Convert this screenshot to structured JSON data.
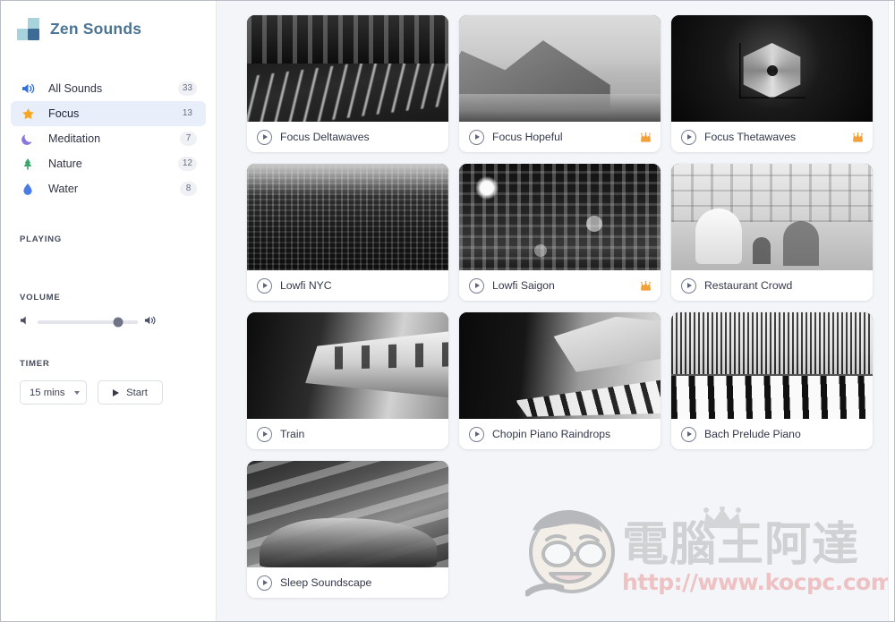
{
  "app": {
    "title": "Zen Sounds",
    "logo_icon": "blocks-logo-icon",
    "brand_color": "#4b7494"
  },
  "sidebar": {
    "nav": [
      {
        "icon": "speaker-icon",
        "label": "All Sounds",
        "count": "33",
        "active": false,
        "color": "#2f6fe0"
      },
      {
        "icon": "star-icon",
        "label": "Focus",
        "count": "13",
        "active": true,
        "color": "#f5a623"
      },
      {
        "icon": "moon-icon",
        "label": "Meditation",
        "count": "7",
        "active": false,
        "color": "#8a74e0"
      },
      {
        "icon": "tree-icon",
        "label": "Nature",
        "count": "12",
        "active": false,
        "color": "#3aa76d"
      },
      {
        "icon": "droplet-icon",
        "label": "Water",
        "count": "8",
        "active": false,
        "color": "#4a7ce8"
      }
    ],
    "playing": {
      "label": "PLAYING",
      "items": []
    },
    "volume": {
      "label": "VOLUME",
      "value_percent": 80,
      "mute_icon": "speaker-low-icon",
      "max_icon": "speaker-high-icon"
    },
    "timer": {
      "label": "TIMER",
      "selected": "15 mins",
      "options": [
        "15 mins"
      ],
      "start_label": "Start",
      "start_icon": "play-icon",
      "caret_icon": "chevron-down-icon"
    }
  },
  "main": {
    "cards": [
      {
        "title": "Focus Deltawaves",
        "premium": false,
        "art": "art-highway",
        "play_icon": "play-circle-icon"
      },
      {
        "title": "Focus Hopeful",
        "premium": true,
        "art": "art-mountain",
        "play_icon": "play-circle-icon"
      },
      {
        "title": "Focus Thetawaves",
        "premium": true,
        "art": "art-skylight",
        "play_icon": "play-circle-icon"
      },
      {
        "title": "Lowfi NYC",
        "premium": false,
        "art": "art-skyline",
        "play_icon": "play-circle-icon"
      },
      {
        "title": "Lowfi Saigon",
        "premium": true,
        "art": "art-street",
        "play_icon": "play-circle-icon"
      },
      {
        "title": "Restaurant Crowd",
        "premium": false,
        "art": "art-cafe",
        "play_icon": "play-circle-icon"
      },
      {
        "title": "Train",
        "premium": false,
        "art": "art-train",
        "play_icon": "play-circle-icon"
      },
      {
        "title": "Chopin Piano Raindrops",
        "premium": false,
        "art": "art-piano1",
        "play_icon": "play-circle-icon"
      },
      {
        "title": "Bach Prelude Piano",
        "premium": false,
        "art": "art-piano2",
        "play_icon": "play-circle-icon"
      },
      {
        "title": "Sleep Soundscape",
        "premium": false,
        "art": "art-sleep",
        "play_icon": "play-circle-icon"
      }
    ],
    "premium_icon": "crown-icon",
    "premium_color": "#f2a13a"
  },
  "watermark": {
    "chinese": "電腦王阿達",
    "url": "http://www.kocpc.com.tw",
    "face_icon": "cartoon-face-icon",
    "crown_icon": "crown-icon",
    "url_color": "#e24b4b"
  }
}
